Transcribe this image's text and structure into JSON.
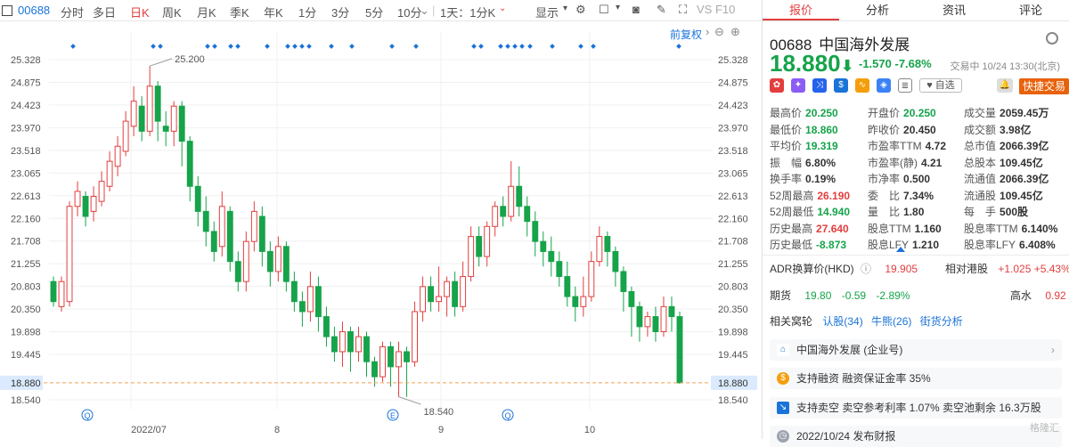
{
  "toolbar": {
    "code": "00688",
    "periods": [
      "分时",
      "多日",
      "日K",
      "周K",
      "月K",
      "季K",
      "年K",
      "1分",
      "3分",
      "5分",
      "10分",
      "1天：1分K"
    ],
    "active_period": "日K",
    "display_label": "显示",
    "vs_label": "VS F10"
  },
  "chart": {
    "restore_label": "前复权",
    "price_ticks": [
      "25.328",
      "24.875",
      "24.423",
      "23.970",
      "23.518",
      "23.065",
      "22.613",
      "22.160",
      "21.708",
      "21.255",
      "20.803",
      "20.350",
      "19.898",
      "19.445",
      "18.880",
      "18.540"
    ],
    "right_ticks": [
      "25.328",
      "24.875",
      "24.423",
      "23.970",
      "23.518",
      "23.065",
      "22.613",
      "22.160",
      "21.708",
      "21.255",
      "20.803",
      "20.350",
      "19.898",
      "19.445",
      "18.880",
      "18.540"
    ],
    "x_labels": [
      "2022/07",
      "8",
      "9",
      "10"
    ],
    "high_label": "25.200",
    "low_label": "18.540",
    "last_price_label": "18.880",
    "marker_q": "Q",
    "marker_e": "E",
    "up_color": "#e23e3e",
    "down_color": "#16a34a"
  },
  "chart_data": {
    "type": "candlestick",
    "ylim": [
      18.4,
      25.5
    ],
    "candles": [
      {
        "o": 20.9,
        "c": 20.5,
        "h": 21.0,
        "l": 20.4
      },
      {
        "o": 20.4,
        "c": 20.9,
        "h": 21.0,
        "l": 20.3
      },
      {
        "o": 20.5,
        "c": 22.4,
        "h": 22.5,
        "l": 20.4
      },
      {
        "o": 22.4,
        "c": 22.7,
        "h": 22.9,
        "l": 22.2
      },
      {
        "o": 22.6,
        "c": 22.2,
        "h": 22.7,
        "l": 22.0
      },
      {
        "o": 22.3,
        "c": 22.6,
        "h": 22.8,
        "l": 22.1
      },
      {
        "o": 22.5,
        "c": 22.9,
        "h": 23.1,
        "l": 22.4
      },
      {
        "o": 22.8,
        "c": 23.3,
        "h": 23.5,
        "l": 22.7
      },
      {
        "o": 23.2,
        "c": 23.6,
        "h": 23.8,
        "l": 23.0
      },
      {
        "o": 23.5,
        "c": 24.1,
        "h": 24.3,
        "l": 23.4
      },
      {
        "o": 24.0,
        "c": 24.5,
        "h": 24.8,
        "l": 23.8
      },
      {
        "o": 24.4,
        "c": 23.9,
        "h": 24.6,
        "l": 23.7
      },
      {
        "o": 23.9,
        "c": 24.8,
        "h": 25.2,
        "l": 23.8
      },
      {
        "o": 24.8,
        "c": 24.1,
        "h": 24.9,
        "l": 23.7
      },
      {
        "o": 24.0,
        "c": 23.9,
        "h": 24.3,
        "l": 23.6
      },
      {
        "o": 23.9,
        "c": 24.4,
        "h": 24.5,
        "l": 23.6
      },
      {
        "o": 24.4,
        "c": 23.7,
        "h": 24.5,
        "l": 23.2
      },
      {
        "o": 23.7,
        "c": 22.8,
        "h": 23.8,
        "l": 22.5
      },
      {
        "o": 22.8,
        "c": 22.3,
        "h": 23.0,
        "l": 22.0
      },
      {
        "o": 22.3,
        "c": 21.9,
        "h": 22.6,
        "l": 21.6
      },
      {
        "o": 21.9,
        "c": 21.5,
        "h": 22.1,
        "l": 21.3
      },
      {
        "o": 21.6,
        "c": 22.4,
        "h": 22.7,
        "l": 21.4
      },
      {
        "o": 22.3,
        "c": 21.3,
        "h": 22.4,
        "l": 21.1
      },
      {
        "o": 21.3,
        "c": 20.9,
        "h": 21.5,
        "l": 20.7
      },
      {
        "o": 20.9,
        "c": 21.7,
        "h": 21.9,
        "l": 20.7
      },
      {
        "o": 21.7,
        "c": 22.3,
        "h": 22.5,
        "l": 21.5
      },
      {
        "o": 22.2,
        "c": 21.5,
        "h": 22.4,
        "l": 21.2
      },
      {
        "o": 21.5,
        "c": 21.1,
        "h": 21.7,
        "l": 20.8
      },
      {
        "o": 21.1,
        "c": 21.6,
        "h": 21.8,
        "l": 20.9
      },
      {
        "o": 21.6,
        "c": 20.9,
        "h": 21.7,
        "l": 20.7
      },
      {
        "o": 20.9,
        "c": 20.5,
        "h": 21.1,
        "l": 20.3
      },
      {
        "o": 20.5,
        "c": 20.3,
        "h": 20.7,
        "l": 20.0
      },
      {
        "o": 20.3,
        "c": 20.8,
        "h": 21.1,
        "l": 20.1
      },
      {
        "o": 20.8,
        "c": 20.2,
        "h": 21.0,
        "l": 19.9
      },
      {
        "o": 20.2,
        "c": 19.8,
        "h": 20.4,
        "l": 19.6
      },
      {
        "o": 19.8,
        "c": 19.5,
        "h": 20.0,
        "l": 19.3
      },
      {
        "o": 19.5,
        "c": 19.9,
        "h": 20.1,
        "l": 19.2
      },
      {
        "o": 19.9,
        "c": 19.5,
        "h": 20.0,
        "l": 19.1
      },
      {
        "o": 19.5,
        "c": 19.8,
        "h": 20.0,
        "l": 19.3
      },
      {
        "o": 19.8,
        "c": 19.3,
        "h": 19.9,
        "l": 19.0
      },
      {
        "o": 19.3,
        "c": 19.0,
        "h": 19.4,
        "l": 18.8
      },
      {
        "o": 19.0,
        "c": 19.6,
        "h": 19.7,
        "l": 18.9
      },
      {
        "o": 19.6,
        "c": 19.2,
        "h": 19.7,
        "l": 18.8
      },
      {
        "o": 19.2,
        "c": 19.5,
        "h": 19.7,
        "l": 18.6
      },
      {
        "o": 19.5,
        "c": 19.3,
        "h": 19.6,
        "l": 18.6
      },
      {
        "o": 19.3,
        "c": 20.3,
        "h": 20.5,
        "l": 19.2
      },
      {
        "o": 20.3,
        "c": 20.8,
        "h": 21.0,
        "l": 20.1
      },
      {
        "o": 20.8,
        "c": 20.5,
        "h": 21.0,
        "l": 20.3
      },
      {
        "o": 20.5,
        "c": 20.6,
        "h": 21.2,
        "l": 20.3
      },
      {
        "o": 20.6,
        "c": 20.9,
        "h": 21.0,
        "l": 20.2
      },
      {
        "o": 20.9,
        "c": 20.4,
        "h": 21.1,
        "l": 20.2
      },
      {
        "o": 20.4,
        "c": 21.0,
        "h": 21.3,
        "l": 20.3
      },
      {
        "o": 21.0,
        "c": 21.8,
        "h": 22.0,
        "l": 20.9
      },
      {
        "o": 21.8,
        "c": 21.4,
        "h": 22.0,
        "l": 21.2
      },
      {
        "o": 21.4,
        "c": 22.0,
        "h": 22.1,
        "l": 21.2
      },
      {
        "o": 22.0,
        "c": 22.4,
        "h": 22.5,
        "l": 21.8
      },
      {
        "o": 22.4,
        "c": 22.2,
        "h": 22.6,
        "l": 22.0
      },
      {
        "o": 22.2,
        "c": 22.8,
        "h": 23.3,
        "l": 22.1
      },
      {
        "o": 22.8,
        "c": 22.4,
        "h": 23.2,
        "l": 22.2
      },
      {
        "o": 22.4,
        "c": 22.1,
        "h": 22.6,
        "l": 21.8
      },
      {
        "o": 22.1,
        "c": 21.7,
        "h": 22.3,
        "l": 21.4
      },
      {
        "o": 21.7,
        "c": 21.5,
        "h": 21.9,
        "l": 21.2
      },
      {
        "o": 21.5,
        "c": 21.3,
        "h": 21.8,
        "l": 21.0
      },
      {
        "o": 21.3,
        "c": 21.0,
        "h": 21.5,
        "l": 20.8
      },
      {
        "o": 21.0,
        "c": 20.6,
        "h": 21.3,
        "l": 20.4
      },
      {
        "o": 20.6,
        "c": 20.4,
        "h": 20.8,
        "l": 20.1
      },
      {
        "o": 20.4,
        "c": 20.6,
        "h": 21.0,
        "l": 20.2
      },
      {
        "o": 20.6,
        "c": 21.3,
        "h": 21.5,
        "l": 20.5
      },
      {
        "o": 21.3,
        "c": 21.8,
        "h": 22.0,
        "l": 21.2
      },
      {
        "o": 21.8,
        "c": 21.5,
        "h": 21.9,
        "l": 21.2
      },
      {
        "o": 21.5,
        "c": 21.1,
        "h": 21.6,
        "l": 20.8
      },
      {
        "o": 21.1,
        "c": 20.7,
        "h": 21.2,
        "l": 20.3
      },
      {
        "o": 20.7,
        "c": 20.4,
        "h": 20.8,
        "l": 19.8
      },
      {
        "o": 20.4,
        "c": 20.0,
        "h": 20.5,
        "l": 19.7
      },
      {
        "o": 20.0,
        "c": 20.2,
        "h": 20.3,
        "l": 19.8
      },
      {
        "o": 20.2,
        "c": 19.9,
        "h": 20.4,
        "l": 19.7
      },
      {
        "o": 19.9,
        "c": 20.4,
        "h": 20.6,
        "l": 19.8
      },
      {
        "o": 20.4,
        "c": 20.2,
        "h": 20.6,
        "l": 19.9
      },
      {
        "o": 20.2,
        "c": 18.88,
        "h": 20.3,
        "l": 18.86
      }
    ]
  },
  "quote": {
    "code": "00688",
    "name": "中国海外发展",
    "price": "18.880",
    "change": "-1.570",
    "change_pct": "-7.68%",
    "status": "交易中 10/24 13:30(北京)",
    "watch_label": "自选",
    "fast_trade_label": "快捷交易",
    "rows": [
      [
        [
          "最高价",
          "20.250",
          "g"
        ],
        [
          "开盘价",
          "20.250",
          "g"
        ],
        [
          "成交量",
          "2059.45万",
          ""
        ]
      ],
      [
        [
          "最低价",
          "18.860",
          "g"
        ],
        [
          "昨收价",
          "20.450",
          ""
        ],
        [
          "成交额",
          "3.98亿",
          ""
        ]
      ],
      [
        [
          "平均价",
          "19.319",
          "g"
        ],
        [
          "市盈率TTM",
          "4.72",
          ""
        ],
        [
          "总市值",
          "2066.39亿",
          ""
        ]
      ],
      [
        [
          "振　幅",
          "6.80%",
          ""
        ],
        [
          "市盈率(静)",
          "4.21",
          ""
        ],
        [
          "总股本",
          "109.45亿",
          ""
        ]
      ],
      [
        [
          "换手率",
          "0.19%",
          ""
        ],
        [
          "市净率",
          "0.500",
          ""
        ],
        [
          "流通值",
          "2066.39亿",
          ""
        ]
      ],
      [
        [
          "52周最高",
          "26.190",
          "r"
        ],
        [
          "委　比",
          "7.34%",
          ""
        ],
        [
          "流通股",
          "109.45亿",
          ""
        ]
      ],
      [
        [
          "52周最低",
          "14.940",
          "g"
        ],
        [
          "量　比",
          "1.80",
          ""
        ],
        [
          "每　手",
          "500股",
          ""
        ]
      ],
      [
        [
          "历史最高",
          "27.640",
          "r"
        ],
        [
          "股息TTM",
          "1.160",
          ""
        ],
        [
          "股息率TTM",
          "6.140%",
          ""
        ]
      ],
      [
        [
          "历史最低",
          "-8.873",
          "g"
        ],
        [
          "股息LFY",
          "1.210",
          ""
        ],
        [
          "股息率LFY",
          "6.408%",
          ""
        ]
      ]
    ],
    "adr_label": "ADR换算价(HKD)",
    "adr_value": "19.905",
    "adr_rel_label": "相对港股",
    "adr_rel_value": "+1.025 +5.43%",
    "futures_label": "期货",
    "futures_price": "19.80",
    "futures_change": "-0.59",
    "futures_pct": "-2.89%",
    "high_water_label": "高水",
    "high_water_value": "0.92",
    "warrants_label": "相关窝轮",
    "warrants_call": "认股(34)",
    "warrants_bull": "牛熊(26)",
    "warrants_street": "街货分析",
    "card1": "中国海外发展 (企业号)",
    "card2": "支持融资 融资保证金率 35%",
    "card3": "支持卖空 卖空参考利率 1.07% 卖空池剩余 16.3万股",
    "card4": "2022/10/24 发布财报"
  },
  "tabs": [
    "报价",
    "分析",
    "资讯",
    "评论"
  ],
  "watermark": "格隆汇"
}
